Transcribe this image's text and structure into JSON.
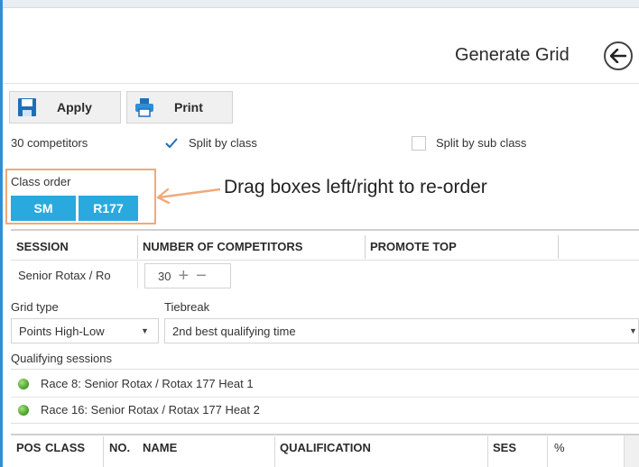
{
  "header": {
    "title": "Generate Grid"
  },
  "toolbar": {
    "apply_label": "Apply",
    "print_label": "Print"
  },
  "options": {
    "competitor_count": "30 competitors",
    "split_by_class": {
      "label": "Split by class",
      "checked": true
    },
    "split_by_sub_class": {
      "label": "Split by sub class",
      "checked": false
    }
  },
  "class_order": {
    "label": "Class order",
    "chips": [
      "SM",
      "R177"
    ]
  },
  "annotation": {
    "text": "Drag boxes left/right to re-order",
    "color": "#f0a97a"
  },
  "session_table": {
    "columns": [
      "SESSION",
      "NUMBER OF COMPETITORS",
      "PROMOTE TOP"
    ],
    "row": {
      "session": "Senior Rotax / Ro",
      "competitors": "30"
    }
  },
  "grid_type": {
    "label": "Grid type",
    "value": "Points High-Low"
  },
  "tiebreak": {
    "label": "Tiebreak",
    "value": "2nd best qualifying time"
  },
  "qualifying": {
    "label": "Qualifying sessions",
    "items": [
      "Race 8: Senior Rotax / Rotax 177 Heat 1",
      "Race 16: Senior Rotax / Rotax 177 Heat 2"
    ]
  },
  "grid_table": {
    "columns": [
      "POS",
      "CLASS",
      "NO.",
      "NAME",
      "QUALIFICATION",
      "SES",
      "%"
    ]
  },
  "colors": {
    "accent": "#2aa9de",
    "window_edge": "#2f8fd5",
    "status_ok": "#3f9e24"
  }
}
